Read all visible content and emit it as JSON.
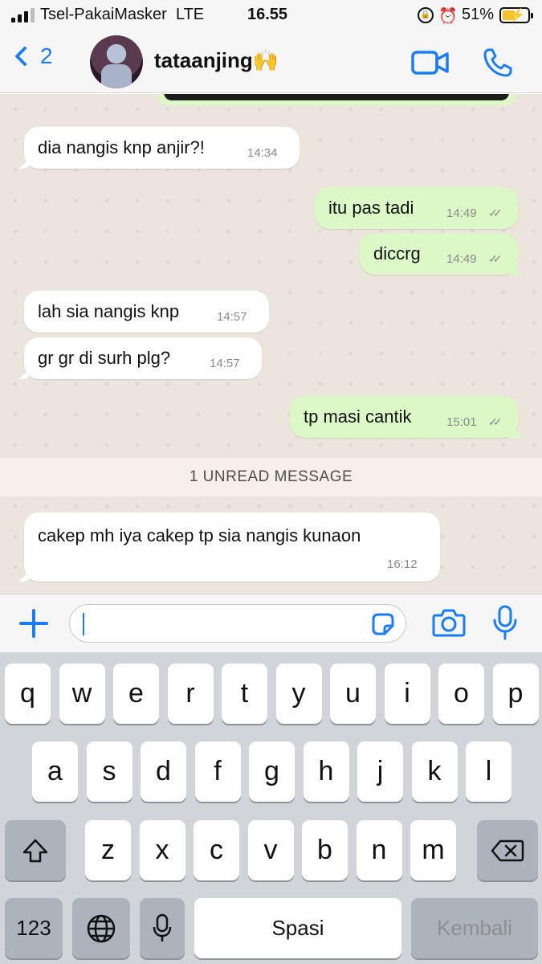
{
  "status_bar": {
    "carrier": "Tsel-PakaiMasker",
    "network": "LTE",
    "time": "16.55",
    "battery_percent": "51%",
    "battery_level": 0.51,
    "signal_bars": 3,
    "icons": [
      "rotation-lock-icon",
      "alarm-icon",
      "battery-charging-icon"
    ]
  },
  "header": {
    "back_count": "2",
    "contact_name": "tataanjing🙌",
    "accent_color": "#1a7cf6"
  },
  "messages": [
    {
      "direction": "in",
      "text": "dia nangis knp anjir?!",
      "time": "14:34"
    },
    {
      "direction": "out",
      "text": "itu pas tadi",
      "time": "14:49",
      "read": true
    },
    {
      "direction": "out",
      "text": "diccrg",
      "time": "14:49",
      "read": true
    },
    {
      "direction": "in",
      "text": "lah sia nangis knp",
      "time": "14:57"
    },
    {
      "direction": "in",
      "text": "gr gr di surh plg?",
      "time": "14:57"
    },
    {
      "direction": "out",
      "text": "tp masi cantik",
      "time": "15:01",
      "read": true
    },
    {
      "direction": "in",
      "text": "cakep mh iya cakep tp sia nangis kunaon",
      "time": "16:12"
    }
  ],
  "unread_banner": "1 UNREAD MESSAGE",
  "composer": {
    "value": ""
  },
  "keyboard": {
    "row1": [
      "q",
      "w",
      "e",
      "r",
      "t",
      "y",
      "u",
      "i",
      "o",
      "p"
    ],
    "row2": [
      "a",
      "s",
      "d",
      "f",
      "g",
      "h",
      "j",
      "k",
      "l"
    ],
    "row3": [
      "z",
      "x",
      "c",
      "v",
      "b",
      "n",
      "m"
    ],
    "numbers_label": "123",
    "space_label": "Spasi",
    "return_label": "Kembali"
  }
}
